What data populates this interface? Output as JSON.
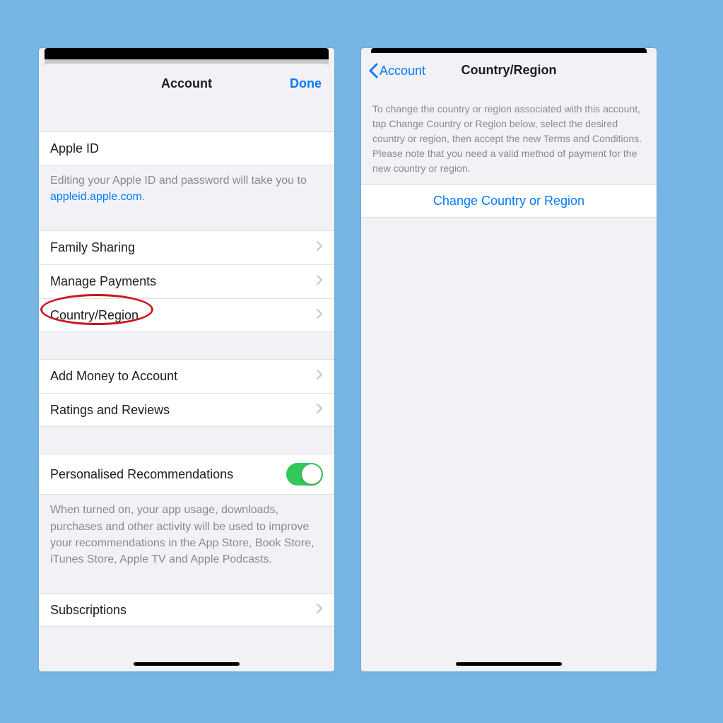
{
  "left": {
    "nav": {
      "title": "Account",
      "done": "Done"
    },
    "appleId": {
      "label": "Apple ID",
      "footer_prefix": "Editing your Apple ID and password will take you to ",
      "footer_link": "appleid.apple.com",
      "footer_suffix": "."
    },
    "rows1": [
      {
        "label": "Family Sharing"
      },
      {
        "label": "Manage Payments"
      },
      {
        "label": "Country/Region",
        "circled": true
      }
    ],
    "rows2": [
      {
        "label": "Add Money to Account"
      },
      {
        "label": "Ratings and Reviews"
      }
    ],
    "toggle": {
      "label": "Personalised Recommendations",
      "footer": "When turned on, your app usage, downloads, purchases and other activity will be used to improve your recommendations in the App Store, Book Store, iTunes Store, Apple TV and Apple Podcasts."
    },
    "rows3": [
      {
        "label": "Subscriptions"
      }
    ]
  },
  "right": {
    "nav": {
      "back": "Account",
      "title": "Country/Region"
    },
    "header": "To change the country or region associated with this account, tap Change Country or Region below, select the desired country or region, then accept the new Terms and Conditions. Please note that you need a valid method of payment for the new country or region.",
    "button": "Change Country or Region"
  }
}
